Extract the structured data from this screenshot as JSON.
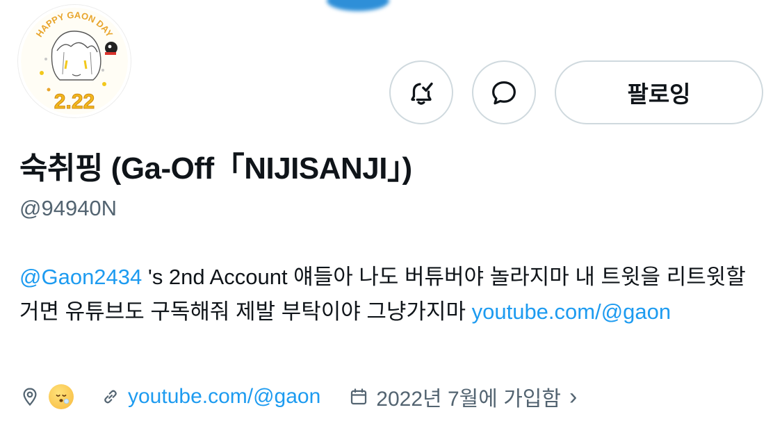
{
  "profile": {
    "display_name": "숙취핑 (Ga-Off「NIJISANJI」)",
    "handle": "@94940N",
    "avatar_text_top": "HAPPY GAON DAY",
    "avatar_text_date": "2.22"
  },
  "actions": {
    "notify_icon": "bell-check-icon",
    "message_icon": "message-bubble-icon",
    "follow_label": "팔로잉"
  },
  "bio": {
    "mention": "@Gaon2434",
    "text": " 's 2nd Account 얘들아 나도 버튜버야 놀라지마 내 트윗을 리트윗할거면 유튜브도 구독해줘 제발 부탁이야 그냥가지마 ",
    "link": "youtube.com/@gaon"
  },
  "meta": {
    "location_icon": "location-pin-icon",
    "location_emoji": "sleepy-face-emoji",
    "website": "youtube.com/@gaon",
    "joined": "2022년 7월에 가입함",
    "chevron": "›"
  },
  "colors": {
    "link": "#1d9bf0",
    "secondary_text": "#536471",
    "border": "#cfd9de"
  }
}
